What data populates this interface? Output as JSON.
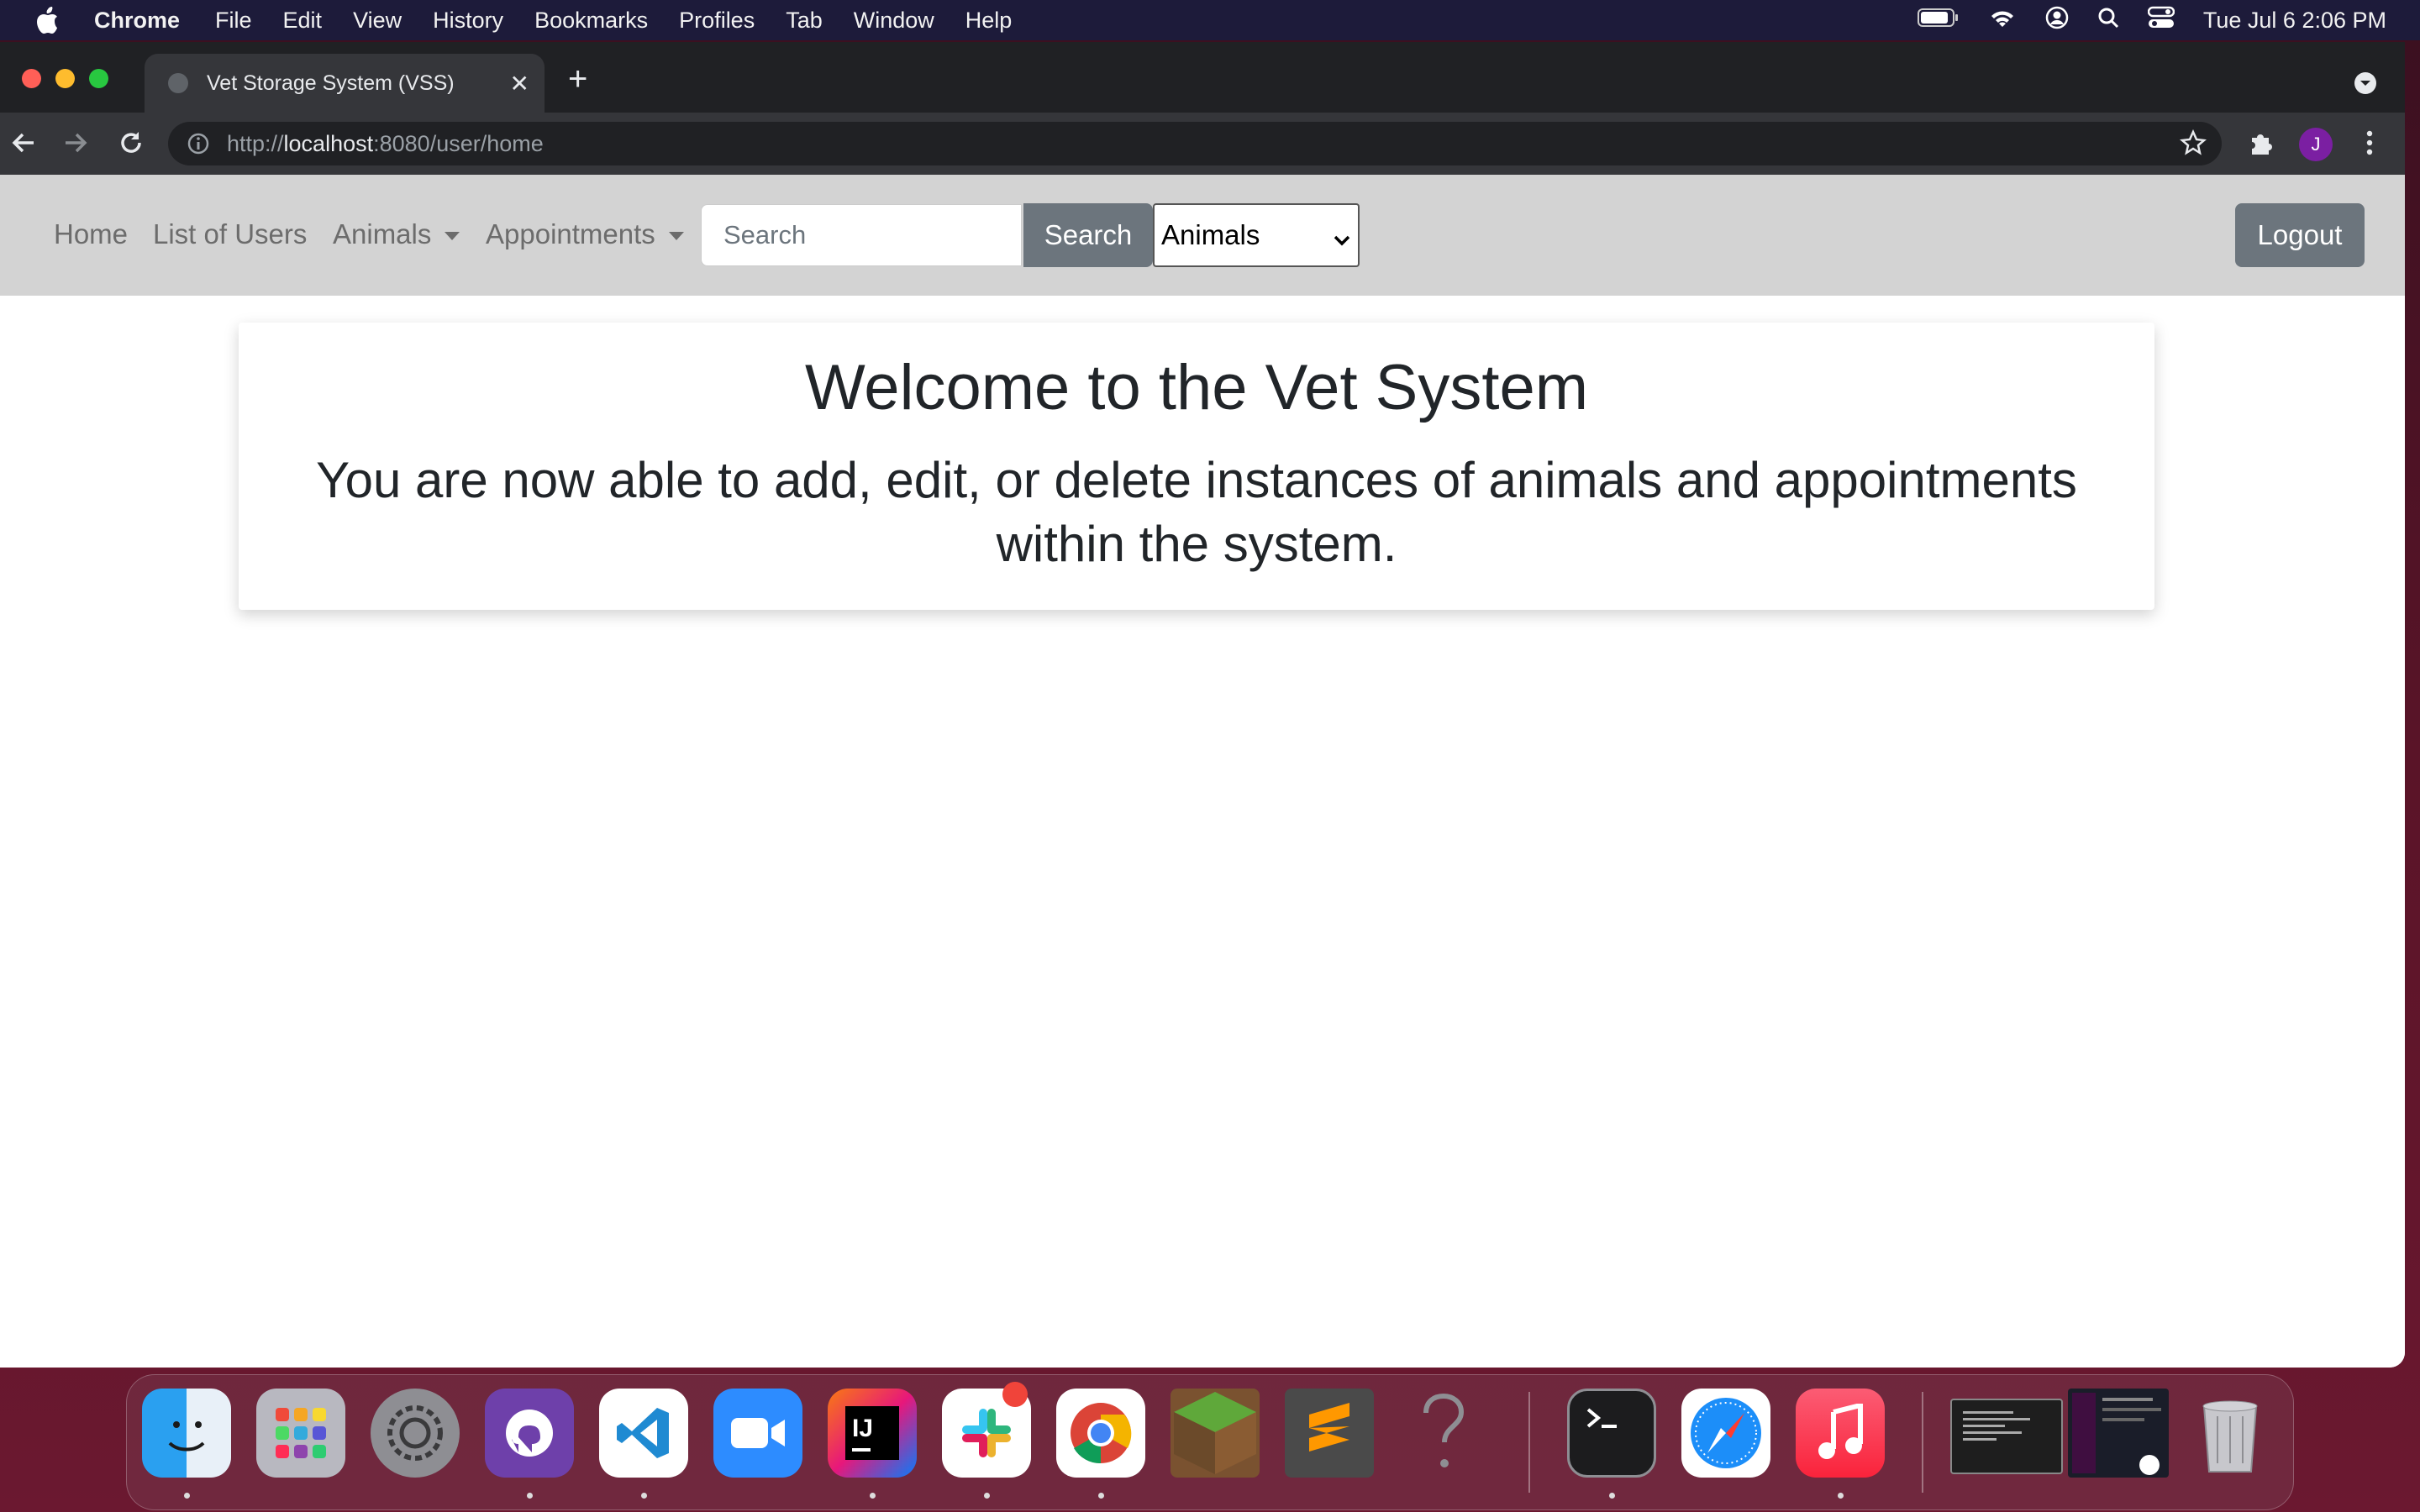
{
  "menubar": {
    "items": [
      "Chrome",
      "File",
      "Edit",
      "View",
      "History",
      "Bookmarks",
      "Profiles",
      "Tab",
      "Window",
      "Help"
    ],
    "clock": "Tue Jul 6  2:06 PM"
  },
  "browser": {
    "tab_title": "Vet Storage System (VSS)",
    "url_scheme": "http://",
    "url_host": "localhost",
    "url_rest": ":8080/user/home",
    "profile_initial": "J"
  },
  "navbar": {
    "home": "Home",
    "users": "List of Users",
    "animals": "Animals",
    "appointments": "Appointments",
    "search_placeholder": "Search",
    "search_button": "Search",
    "search_type_selected": "Animals",
    "logout": "Logout"
  },
  "main": {
    "title": "Welcome to the Vet System",
    "subtitle": "You are now able to add, edit, or delete instances of animals and appointments within the system."
  },
  "dock": {
    "apps": [
      "finder-icon",
      "launchpad-icon",
      "system-preferences-icon",
      "github-desktop-icon",
      "vscode-icon",
      "zoom-icon",
      "intellij-icon",
      "slack-icon",
      "chrome-icon",
      "minecraft-icon",
      "sublime-text-icon",
      "unknown-app-icon",
      "terminal-icon",
      "safari-icon",
      "music-icon",
      "trash-icon"
    ]
  }
}
